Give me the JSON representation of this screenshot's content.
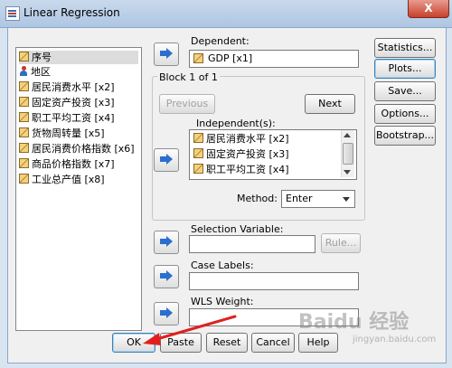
{
  "window": {
    "title": "Linear Regression",
    "close": "X"
  },
  "variables": [
    {
      "label": "序号",
      "icon": "ruler-icon",
      "selected": true
    },
    {
      "label": "地区",
      "icon": "person-icon"
    },
    {
      "label": "居民消费水平 [x2]",
      "icon": "ruler-icon"
    },
    {
      "label": "固定资产投资 [x3]",
      "icon": "ruler-icon"
    },
    {
      "label": "职工平均工资 [x4]",
      "icon": "ruler-icon"
    },
    {
      "label": "货物周转量 [x5]",
      "icon": "ruler-icon"
    },
    {
      "label": "居民消费价格指数 [x6]",
      "icon": "ruler-icon"
    },
    {
      "label": "商品价格指数 [x7]",
      "icon": "ruler-icon"
    },
    {
      "label": "工业总产值 [x8]",
      "icon": "ruler-icon"
    }
  ],
  "dependent": {
    "label": "Dependent:",
    "value": "GDP [x1]"
  },
  "block": {
    "label": "Block 1 of 1",
    "previous": "Previous",
    "next": "Next",
    "independent_label": "Independent(s):",
    "independents": [
      "居民消费水平 [x2]",
      "固定资产投资 [x3]",
      "职工平均工资 [x4]"
    ],
    "method_label": "Method:",
    "method_value": "Enter"
  },
  "selection": {
    "label": "Selection Variable:",
    "value": "",
    "rule": "Rule..."
  },
  "case_labels": {
    "label": "Case Labels:",
    "value": ""
  },
  "wls": {
    "label": "WLS Weight:",
    "value": ""
  },
  "side_buttons": [
    "Statistics...",
    "Plots...",
    "Save...",
    "Options...",
    "Bootstrap..."
  ],
  "bottom_buttons": [
    "OK",
    "Paste",
    "Reset",
    "Cancel",
    "Help"
  ],
  "watermark": {
    "text": "Baidu 经验",
    "sub": "jingyan.baidu.com"
  }
}
